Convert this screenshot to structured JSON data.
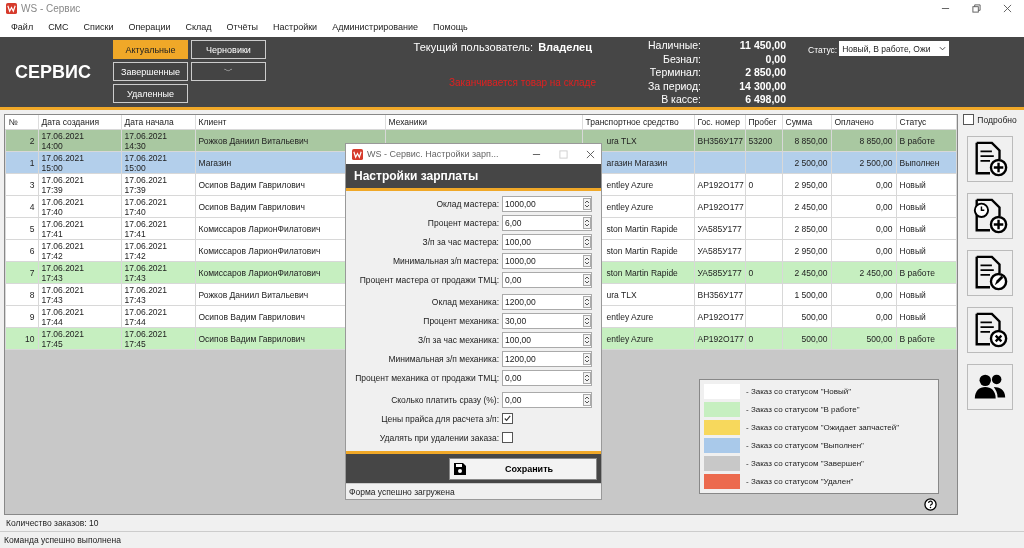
{
  "window": {
    "title": "WS - Сервис"
  },
  "menu": [
    "Файл",
    "СМС",
    "Списки",
    "Операции",
    "Склад",
    "Отчёты",
    "Настройки",
    "Администрирование",
    "Помощь"
  ],
  "header": {
    "title": "СЕРВИС",
    "filters": [
      {
        "label": "Актуальные",
        "selected": true
      },
      {
        "label": "Черновики",
        "selected": false
      },
      {
        "label": "Завершенные",
        "selected": false
      },
      {
        "label": "Удаленные",
        "selected": false
      }
    ],
    "more_glyph": "﹀",
    "user_label": "Текущий пользователь:",
    "user_value": "Владелец",
    "warning": "Заканчивается товар на складе",
    "totals": [
      {
        "label": "Наличные:",
        "value": "11 450,00"
      },
      {
        "label": "Безнал:",
        "value": "0,00"
      },
      {
        "label": "Терминал:",
        "value": "2 850,00"
      },
      {
        "label": "За период:",
        "value": "14 300,00"
      },
      {
        "label": "В кассе:",
        "value": "6 498,00"
      }
    ],
    "status_label": "Статус:",
    "status_value": "Новый, В работе, Ожи"
  },
  "table": {
    "columns": [
      "№",
      "Дата создания",
      "Дата начала",
      "Клиент",
      "Механики",
      "Транспортное средство",
      "Гос. номер",
      "Пробег",
      "Сумма",
      "Оплачено",
      "Статус"
    ],
    "rows": [
      {
        "color": "#a9c8a1",
        "no": "2",
        "created": "17.06.2021 14:00",
        "started": "17.06.2021 14:30",
        "client": "Рожков Даниил Витальевич",
        "vehicle": "ura TLX",
        "plate": "ВН356У177",
        "mileage": "53200",
        "sum": "8 850,00",
        "paid": "8 850,00",
        "status": "В работе"
      },
      {
        "color": "#b3cfeb",
        "no": "1",
        "created": "17.06.2021 15:00",
        "started": "17.06.2021 15:00",
        "client": "Магазин",
        "vehicle": "агазин Магазин",
        "plate": "",
        "mileage": "",
        "sum": "2 500,00",
        "paid": "2 500,00",
        "status": "Выполнен"
      },
      {
        "color": "#ffffff",
        "no": "3",
        "created": "17.06.2021 17:39",
        "started": "17.06.2021 17:39",
        "client": "Осипов Вадим Гаврилович",
        "vehicle": "entley Azure",
        "plate": "АР192О177",
        "mileage": "0",
        "sum": "2 950,00",
        "paid": "0,00",
        "status": "Новый"
      },
      {
        "color": "#ffffff",
        "no": "4",
        "created": "17.06.2021 17:40",
        "started": "17.06.2021 17:40",
        "client": "Осипов Вадим Гаврилович",
        "vehicle": "entley Azure",
        "plate": "АР192О177",
        "mileage": "",
        "sum": "2 450,00",
        "paid": "0,00",
        "status": "Новый"
      },
      {
        "color": "#ffffff",
        "no": "5",
        "created": "17.06.2021 17:41",
        "started": "17.06.2021 17:41",
        "client": "Комиссаров ЛарионФилатович",
        "vehicle": "ston Martin Rapide",
        "plate": "УА585У177",
        "mileage": "",
        "sum": "2 850,00",
        "paid": "0,00",
        "status": "Новый"
      },
      {
        "color": "#ffffff",
        "no": "6",
        "created": "17.06.2021 17:42",
        "started": "17.06.2021 17:42",
        "client": "Комиссаров ЛарионФилатович",
        "vehicle": "ston Martin Rapide",
        "plate": "УА585У177",
        "mileage": "",
        "sum": "2 950,00",
        "paid": "0,00",
        "status": "Новый"
      },
      {
        "color": "#c6efc0",
        "no": "7",
        "created": "17.06.2021 17:43",
        "started": "17.06.2021 17:43",
        "client": "Комиссаров ЛарионФилатович",
        "vehicle": "ston Martin Rapide",
        "plate": "УА585У177",
        "mileage": "0",
        "sum": "2 450,00",
        "paid": "2 450,00",
        "status": "В работе"
      },
      {
        "color": "#ffffff",
        "no": "8",
        "created": "17.06.2021 17:43",
        "started": "17.06.2021 17:43",
        "client": "Рожков Даниил Витальевич",
        "vehicle": "ura TLX",
        "plate": "ВН356У177",
        "mileage": "",
        "sum": "1 500,00",
        "paid": "0,00",
        "status": "Новый"
      },
      {
        "color": "#ffffff",
        "no": "9",
        "created": "17.06.2021 17:44",
        "started": "17.06.2021 17:44",
        "client": "Осипов Вадим Гаврилович",
        "vehicle": "entley Azure",
        "plate": "АР192О177",
        "mileage": "",
        "sum": "500,00",
        "paid": "0,00",
        "status": "Новый"
      },
      {
        "color": "#c6efc0",
        "no": "10",
        "created": "17.06.2021 17:45",
        "started": "17.06.2021 17:45",
        "client": "Осипов Вадим Гаврилович",
        "vehicle": "entley Azure",
        "plate": "АР192О177",
        "mileage": "0",
        "sum": "500,00",
        "paid": "500,00",
        "status": "В работе"
      }
    ]
  },
  "legend": [
    {
      "color": "#ffffff",
      "label": "- Заказ со статусом \"Новый\""
    },
    {
      "color": "#c6efc0",
      "label": "- Заказ со статусом \"В работе\""
    },
    {
      "color": "#f7d85c",
      "label": "- Заказ со статусом \"Ожидает запчастей\""
    },
    {
      "color": "#a9c9ea",
      "label": "- Заказ со статусом \"Выполнен\""
    },
    {
      "color": "#c8c8c8",
      "label": "- Заказ со статусом \"Завершен\""
    },
    {
      "color": "#ec6a4e",
      "label": "- Заказ со статусом \"Удален\""
    }
  ],
  "details_checkbox": {
    "label": "Подробно",
    "checked": false
  },
  "order_count": "Количество заказов: 10",
  "status_bar": "Команда успешно выполнена",
  "dialog": {
    "title": "WS - Сервис. Настройки зарп...",
    "heading": "Настройки зарплаты",
    "groups": [
      [
        {
          "kind": "number",
          "label": "Оклад мастера:",
          "value": "1000,00"
        },
        {
          "kind": "number",
          "label": "Процент мастера:",
          "value": "6,00"
        },
        {
          "kind": "number",
          "label": "З/п за час мастера:",
          "value": "100,00"
        },
        {
          "kind": "number",
          "label": "Минимальная з/п мастера:",
          "value": "1000,00"
        },
        {
          "kind": "number",
          "label": "Процент мастера от продажи ТМЦ:",
          "value": "0,00"
        }
      ],
      [
        {
          "kind": "number",
          "label": "Оклад механика:",
          "value": "1200,00"
        },
        {
          "kind": "number",
          "label": "Процент механика:",
          "value": "30,00"
        },
        {
          "kind": "number",
          "label": "З/п за час механика:",
          "value": "100,00"
        },
        {
          "kind": "number",
          "label": "Минимальная з/п механика:",
          "value": "1200,00"
        },
        {
          "kind": "number",
          "label": "Процент механика от продажи ТМЦ:",
          "value": "0,00"
        }
      ],
      [
        {
          "kind": "number",
          "label": "Сколько платить сразу (%):",
          "value": "0,00"
        },
        {
          "kind": "checkbox",
          "label": "Цены прайса для расчета з/п:",
          "checked": true
        },
        {
          "kind": "checkbox",
          "label": "Удалять при удалении заказа:",
          "checked": false
        }
      ]
    ],
    "save_label": "Сохранить",
    "status": "Форма успешно загружена"
  }
}
